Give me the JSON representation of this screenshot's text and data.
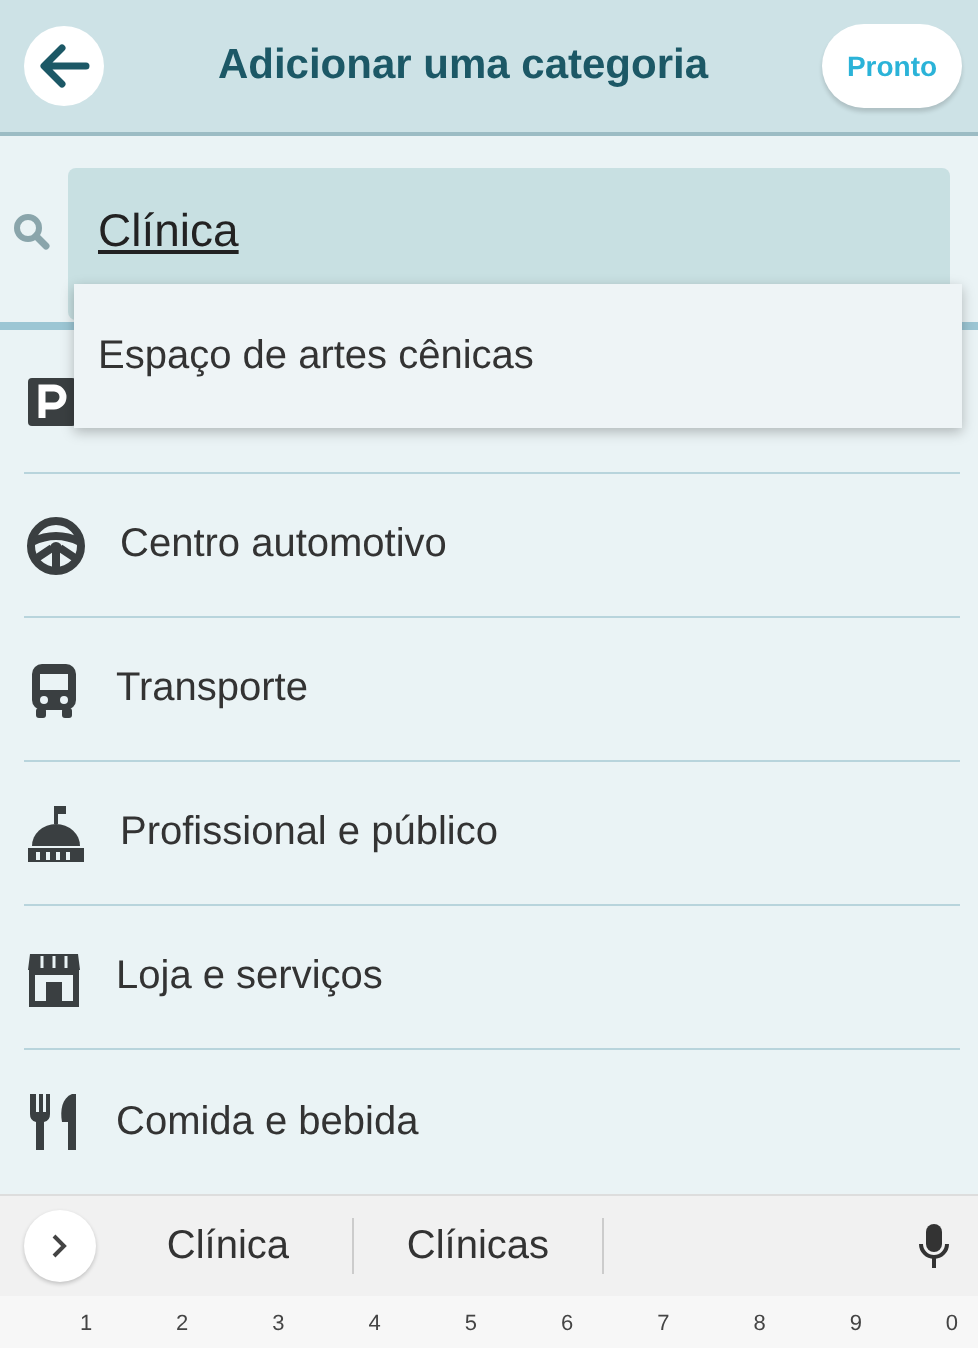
{
  "header": {
    "title": "Adicionar uma categoria",
    "done_button": "Pronto"
  },
  "search": {
    "value": "Clínica"
  },
  "dropdown": {
    "items": [
      "Espaço de artes cênicas"
    ]
  },
  "categories": [
    {
      "kind": "parking"
    },
    {
      "kind": "car",
      "label": "Centro automotivo"
    },
    {
      "kind": "bus",
      "label": "Transporte"
    },
    {
      "kind": "civic",
      "label": "Profissional e público"
    },
    {
      "kind": "store",
      "label": "Loja e serviços"
    },
    {
      "kind": "food",
      "label": "Comida e bebida"
    }
  ],
  "keyboard": {
    "suggestions": [
      "Clínica",
      "Clínicas"
    ],
    "number_keys": [
      "1",
      "2",
      "3",
      "4",
      "5",
      "6",
      "7",
      "8",
      "9",
      "0"
    ]
  }
}
